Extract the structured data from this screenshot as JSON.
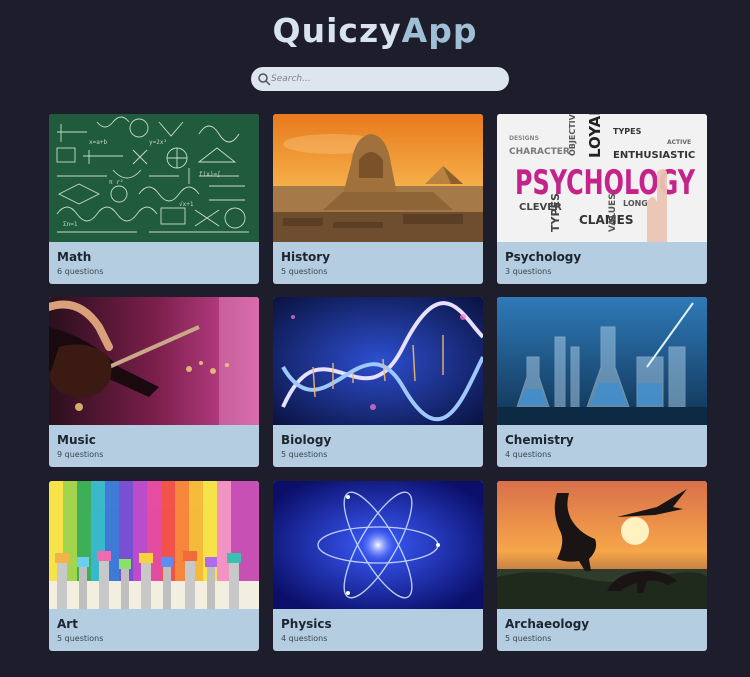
{
  "app": {
    "logo_part1": "Quiczy",
    "logo_part2": "App"
  },
  "search": {
    "placeholder": "Search...",
    "icon": "search-icon"
  },
  "categories": [
    {
      "title": "Math",
      "count": "6 questions",
      "image": "math-chalkboard-image"
    },
    {
      "title": "History",
      "count": "5 questions",
      "image": "sphinx-pyramid-image"
    },
    {
      "title": "Psychology",
      "count": "3 questions",
      "image": "psychology-wordcloud-image"
    },
    {
      "title": "Music",
      "count": "9 questions",
      "image": "guitar-concert-image"
    },
    {
      "title": "Biology",
      "count": "5 questions",
      "image": "dna-helix-image"
    },
    {
      "title": "Chemistry",
      "count": "4 questions",
      "image": "lab-glassware-image"
    },
    {
      "title": "Art",
      "count": "5 questions",
      "image": "paintbrushes-image"
    },
    {
      "title": "Physics",
      "count": "4 questions",
      "image": "atom-energy-image"
    },
    {
      "title": "Archaeology",
      "count": "5 questions",
      "image": "dinosaur-sunset-image"
    }
  ],
  "image_text": {
    "psychology_word": "PSYCHOLOGY",
    "psychology_words": [
      "LOYAL",
      "TYPES",
      "ENTHUSIASTIC",
      "CLEVER",
      "CLAMES",
      "VALUES",
      "OBJECTIVE",
      "LONG",
      "CHARACTER",
      "DESIGNS",
      "ACTIVE"
    ]
  },
  "colors": {
    "background": "#1e1d2c",
    "card": "#b4cde0",
    "search_bg": "#dde6ef",
    "logo_light": "#d7e3ee",
    "logo_accent": "#9fbfd6"
  }
}
